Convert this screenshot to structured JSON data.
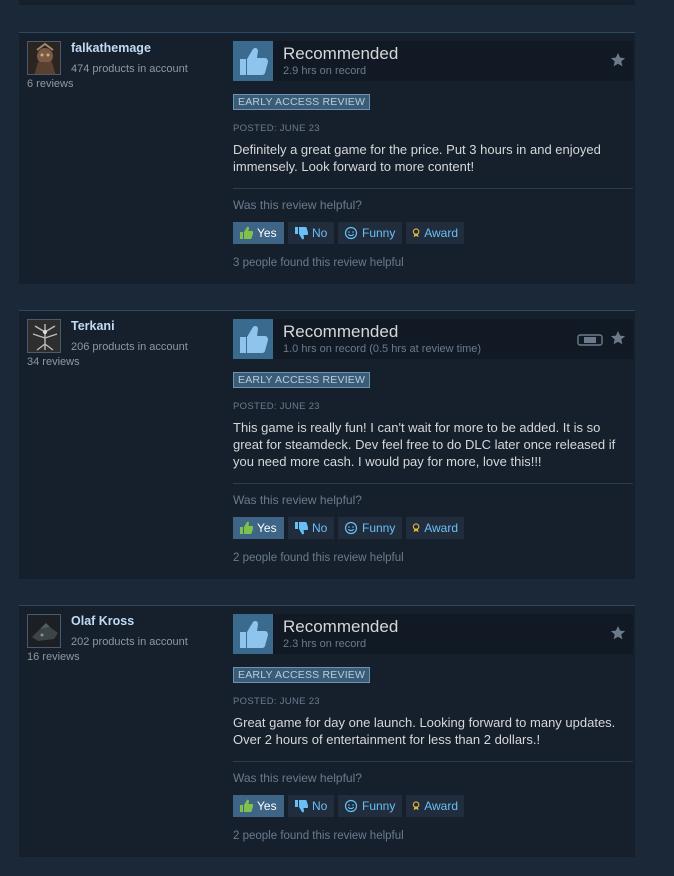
{
  "labels": {
    "recommended": "Recommended",
    "early_access": "EARLY ACCESS REVIEW",
    "helpful_question": "Was this review helpful?",
    "yes": "Yes",
    "no": "No",
    "funny": "Funny",
    "award": "Award"
  },
  "colors": {
    "page_bg": "#1b2838",
    "card_bg": "#16202d",
    "accent_link": "#67c1f5",
    "thumb_bg": "#3a6a8d"
  },
  "reviews": [
    {
      "author": "falkathemage",
      "products": "474 products in account",
      "review_count": "6 reviews",
      "hours": "2.9 hrs on record",
      "posted": "POSTED: JUNE 23",
      "content": "Definitely a great game for the price. Put 3 hours in and enjoyed immensely. Look forward to more content!",
      "found_helpful": "3 people found this review helpful"
    },
    {
      "author": "Terkani",
      "products": "206 products in account",
      "review_count": "34 reviews",
      "hours": "1.0 hrs on record (0.5 hrs at review time)",
      "posted": "POSTED: JUNE 23",
      "content": "This game is really fun! I can't wait for more to be added. It is so great for steamdeck. Dev feel free to do DLC later once released if you need more cash. I would pay for more, love this!!!",
      "found_helpful": "2 people found this review helpful"
    },
    {
      "author": "Olaf Kross",
      "products": "202 products in account",
      "review_count": "16 reviews",
      "hours": "2.3 hrs on record",
      "posted": "POSTED: JUNE 23",
      "content": "Great game for day one launch. Looking forward to many updates. Over 2 hours of entertainment for less than 2 dollars.!",
      "found_helpful": "2 people found this review helpful"
    }
  ]
}
